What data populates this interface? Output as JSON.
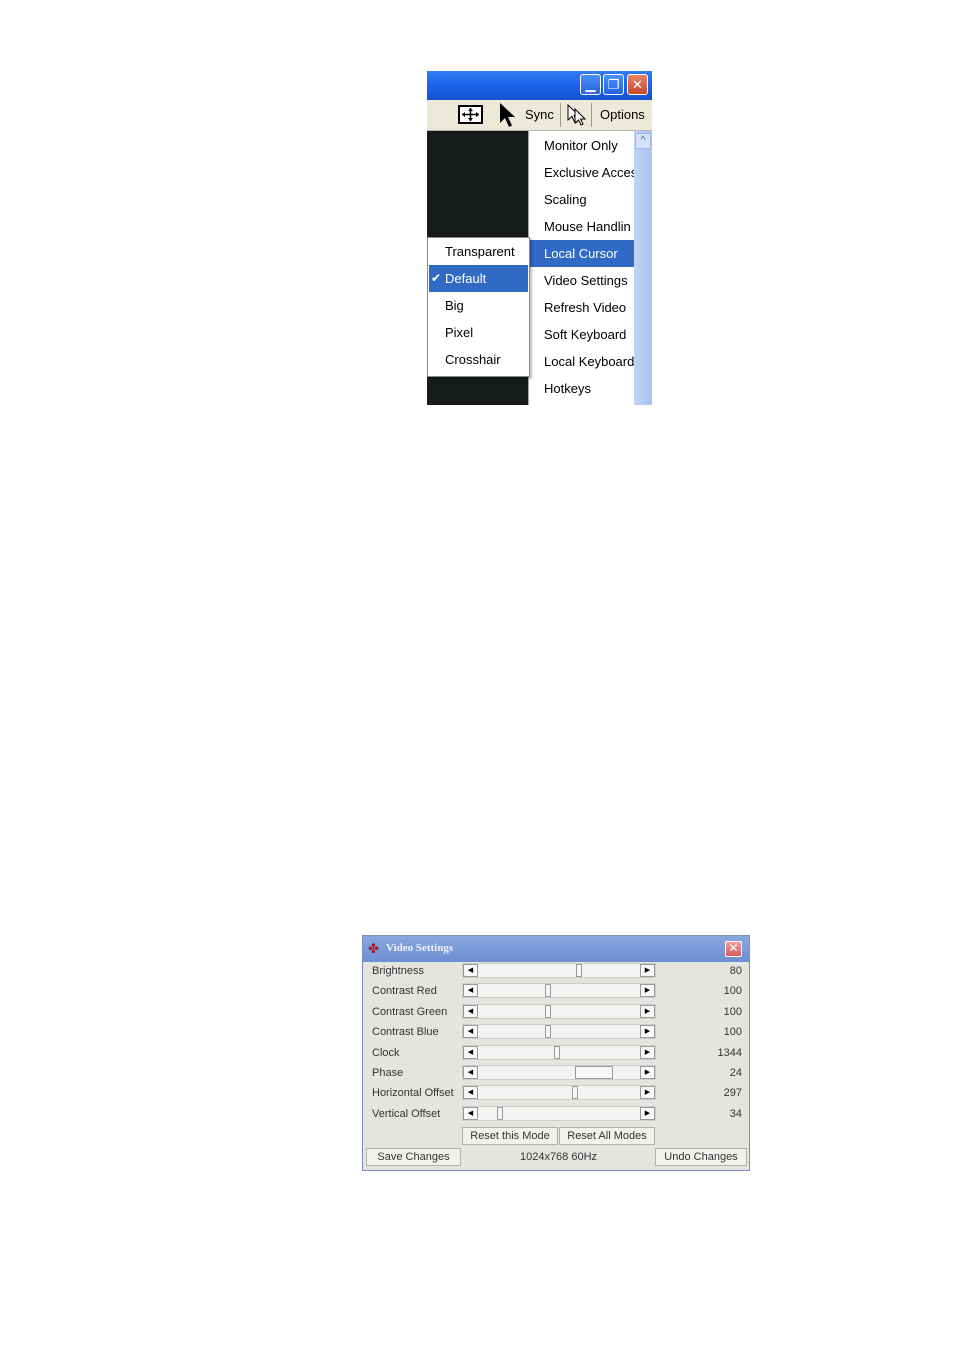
{
  "kvm_window": {
    "minimize_glyph": "▁",
    "maximize_glyph": "❐",
    "close_glyph": "✕",
    "toolbar": {
      "sync_label": "Sync",
      "options_label": "Options"
    },
    "options_menu": {
      "items": [
        {
          "label": "Monitor Only"
        },
        {
          "label": "Exclusive Acces"
        },
        {
          "label": "Scaling"
        },
        {
          "label": "Mouse Handlin"
        },
        {
          "label": "Local Cursor",
          "selected": true
        },
        {
          "label": "Video Settings"
        },
        {
          "label": "Refresh Video"
        },
        {
          "label": "Soft Keyboard"
        },
        {
          "label": "Local Keyboard"
        },
        {
          "label": "Hotkeys"
        }
      ],
      "scroll_up_glyph": "^"
    },
    "cursor_submenu": {
      "items": [
        {
          "label": "Transparent"
        },
        {
          "label": "Default",
          "selected": true,
          "checked": true
        },
        {
          "label": "Big"
        },
        {
          "label": "Pixel"
        },
        {
          "label": "Crosshair"
        }
      ],
      "check_glyph": "✔"
    }
  },
  "video_settings": {
    "title": "Video Settings",
    "close_glyph": "✕",
    "app_icon_glyph": "✤",
    "arrow_left_glyph": "◀",
    "arrow_right_glyph": "▶",
    "sliders": [
      {
        "label": "Brightness",
        "value": "80",
        "level": 0.63
      },
      {
        "label": "Contrast Red",
        "value": "100",
        "level": 0.43
      },
      {
        "label": "Contrast Green",
        "value": "100",
        "level": 0.43
      },
      {
        "label": "Contrast Blue",
        "value": "100",
        "level": 0.43
      },
      {
        "label": "Clock",
        "value": "1344",
        "level": 0.49
      },
      {
        "label": "Phase",
        "value": "24",
        "level": 0.78
      },
      {
        "label": "Horizontal Offset",
        "value": "297",
        "level": 0.6
      },
      {
        "label": "Vertical Offset",
        "value": "34",
        "level": 0.12
      }
    ],
    "buttons": {
      "reset_mode": "Reset this Mode",
      "reset_all": "Reset All Modes",
      "save": "Save Changes",
      "undo": "Undo Changes"
    },
    "status": "1024x768 60Hz"
  },
  "colors": {
    "menu_highlight": "#316ac5",
    "title_blue": "#1a5fe6",
    "dialog_title": "#6d8fd1"
  }
}
